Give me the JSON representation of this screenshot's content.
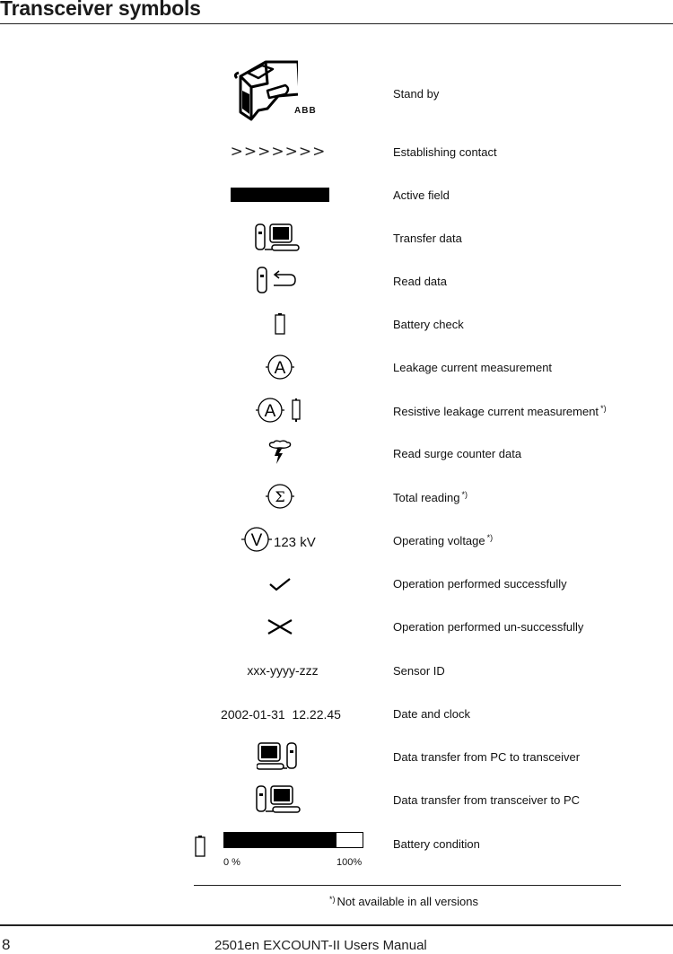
{
  "page": {
    "title": "Transceiver symbols",
    "footnote_marker": "*)",
    "footnote_text": "Not available in all versions",
    "page_number": "8",
    "manual_title": "2501en EXCOUNT-II Users Manual"
  },
  "symbols": [
    {
      "icon": "transceiver-standby-icon",
      "logo_text": "ABB",
      "label": "Stand by",
      "note": ""
    },
    {
      "icon": "establishing-contact-icon",
      "symbol_text": ">>>>>>>",
      "label": "Establishing contact",
      "note": ""
    },
    {
      "icon": "active-field-icon",
      "label": "Active field",
      "note": ""
    },
    {
      "icon": "transfer-data-icon",
      "label": "Transfer data",
      "note": ""
    },
    {
      "icon": "read-data-icon",
      "label": "Read data",
      "note": ""
    },
    {
      "icon": "battery-icon",
      "label": "Battery check",
      "note": ""
    },
    {
      "icon": "ammeter-icon",
      "symbol_text": "A",
      "label": "Leakage current measurement",
      "note": ""
    },
    {
      "icon": "ammeter-resistor-icon",
      "symbol_text": "A",
      "label": "Resistive leakage current measurement",
      "note": "*)"
    },
    {
      "icon": "surge-lightning-icon",
      "label": "Read surge counter data",
      "note": ""
    },
    {
      "icon": "sigma-icon",
      "symbol_text": "Σ",
      "label": "Total reading",
      "note": "*)"
    },
    {
      "icon": "voltmeter-icon",
      "symbol_text": "V",
      "value_text": "123 kV",
      "label": "Operating voltage",
      "note": "*)"
    },
    {
      "icon": "checkmark-icon",
      "label": "Operation performed successfully",
      "note": ""
    },
    {
      "icon": "cross-icon",
      "label": "Operation performed un-successfully",
      "note": ""
    },
    {
      "icon": "sensor-id-text",
      "symbol_text": "xxx-yyyy-zzz",
      "label": "Sensor ID",
      "note": ""
    },
    {
      "icon": "date-clock-text",
      "symbol_text": "2002-01-31  12.22.45",
      "label": "Date and clock",
      "note": ""
    },
    {
      "icon": "pc-to-transceiver-icon",
      "label": "Data transfer from PC to transceiver",
      "note": ""
    },
    {
      "icon": "transceiver-to-pc-icon",
      "label": "Data transfer from transceiver to PC",
      "note": ""
    }
  ],
  "battery_condition": {
    "label": "Battery condition",
    "min_label": "0 %",
    "max_label": "100%",
    "level_percent": 81
  }
}
